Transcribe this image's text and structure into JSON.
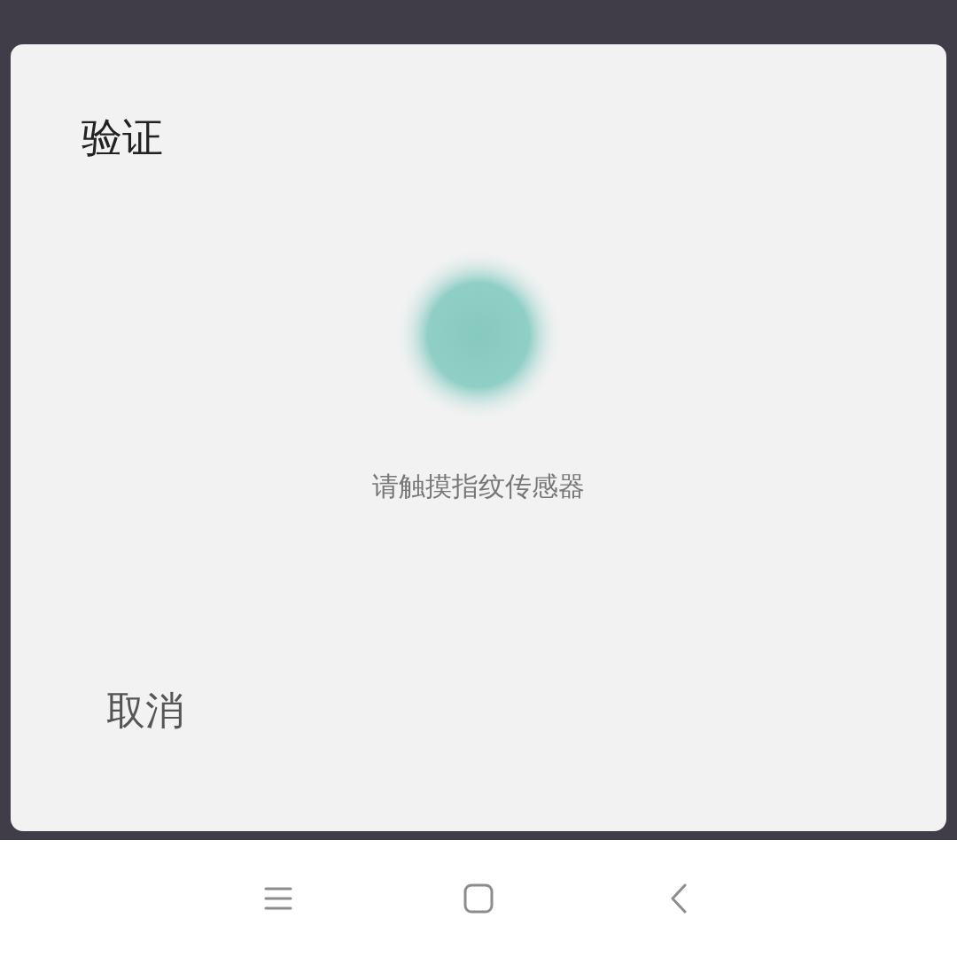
{
  "dialog": {
    "title": "验证",
    "message": "请触摸指纹传感器",
    "cancel_button": "取消"
  },
  "nav_bar": {
    "buttons": [
      {
        "kind": "menu"
      },
      {
        "kind": "home"
      },
      {
        "kind": "back"
      }
    ]
  }
}
